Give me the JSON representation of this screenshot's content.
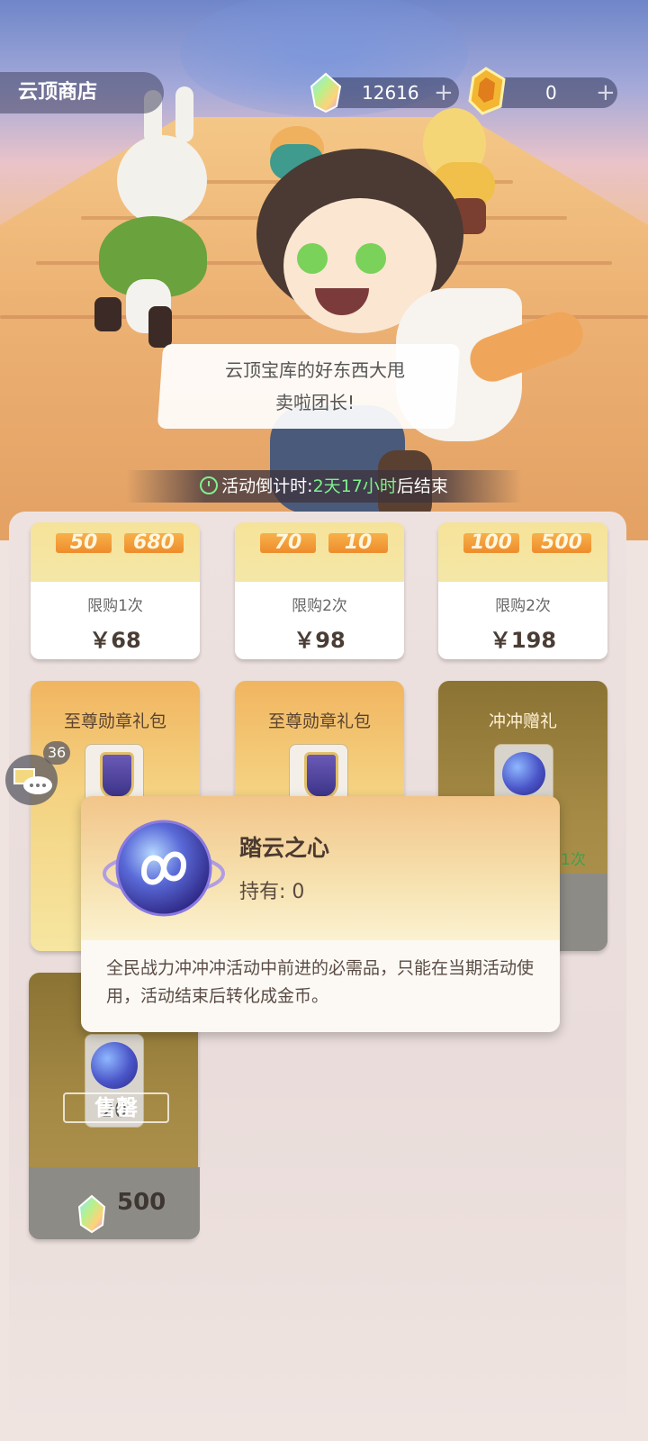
{
  "header": {
    "title": "云顶商店",
    "currency_gem": {
      "icon": "rainbow-gem-icon",
      "value": "12616",
      "plus": "+"
    },
    "currency_token": {
      "icon": "gold-token-icon",
      "value": "0",
      "plus": "+"
    }
  },
  "dialog_bubble": {
    "line1": "云顶宝库的好东西大甩",
    "line2": "卖啦团长!"
  },
  "countdown": {
    "prefix": "活动倒计时:",
    "time": "2天17小时",
    "suffix": "后结束"
  },
  "row1": [
    {
      "tag_a": "50",
      "tag_b": "680",
      "limit": "限购1次",
      "price": "￥68"
    },
    {
      "tag_a": "70",
      "tag_b": "10",
      "limit": "限购2次",
      "price": "￥98"
    },
    {
      "tag_a": "100",
      "tag_b": "500",
      "limit": "限购2次",
      "price": "￥198"
    }
  ],
  "row2": [
    {
      "title": "至尊勋章礼包",
      "icon": "medal-shield-icon"
    },
    {
      "title": "至尊勋章礼包",
      "icon": "medal-shield-icon"
    },
    {
      "title": "冲冲赠礼",
      "icon": "cloud-orb-icon",
      "limit_partial": "1次"
    }
  ],
  "side_chat": {
    "icon": "chat-mail-icon",
    "count": "36"
  },
  "popup": {
    "item_name": "踏云之心",
    "hold_label": "持有:",
    "hold_value": "0",
    "description": "全民战力冲冲冲活动中前进的必需品，只能在当期活动使用，活动结束后转化成金币。"
  },
  "row3": [
    {
      "item_count": "20",
      "soldout": "售罄",
      "cost": "500",
      "cost_icon": "rainbow-gem-icon"
    }
  ]
}
